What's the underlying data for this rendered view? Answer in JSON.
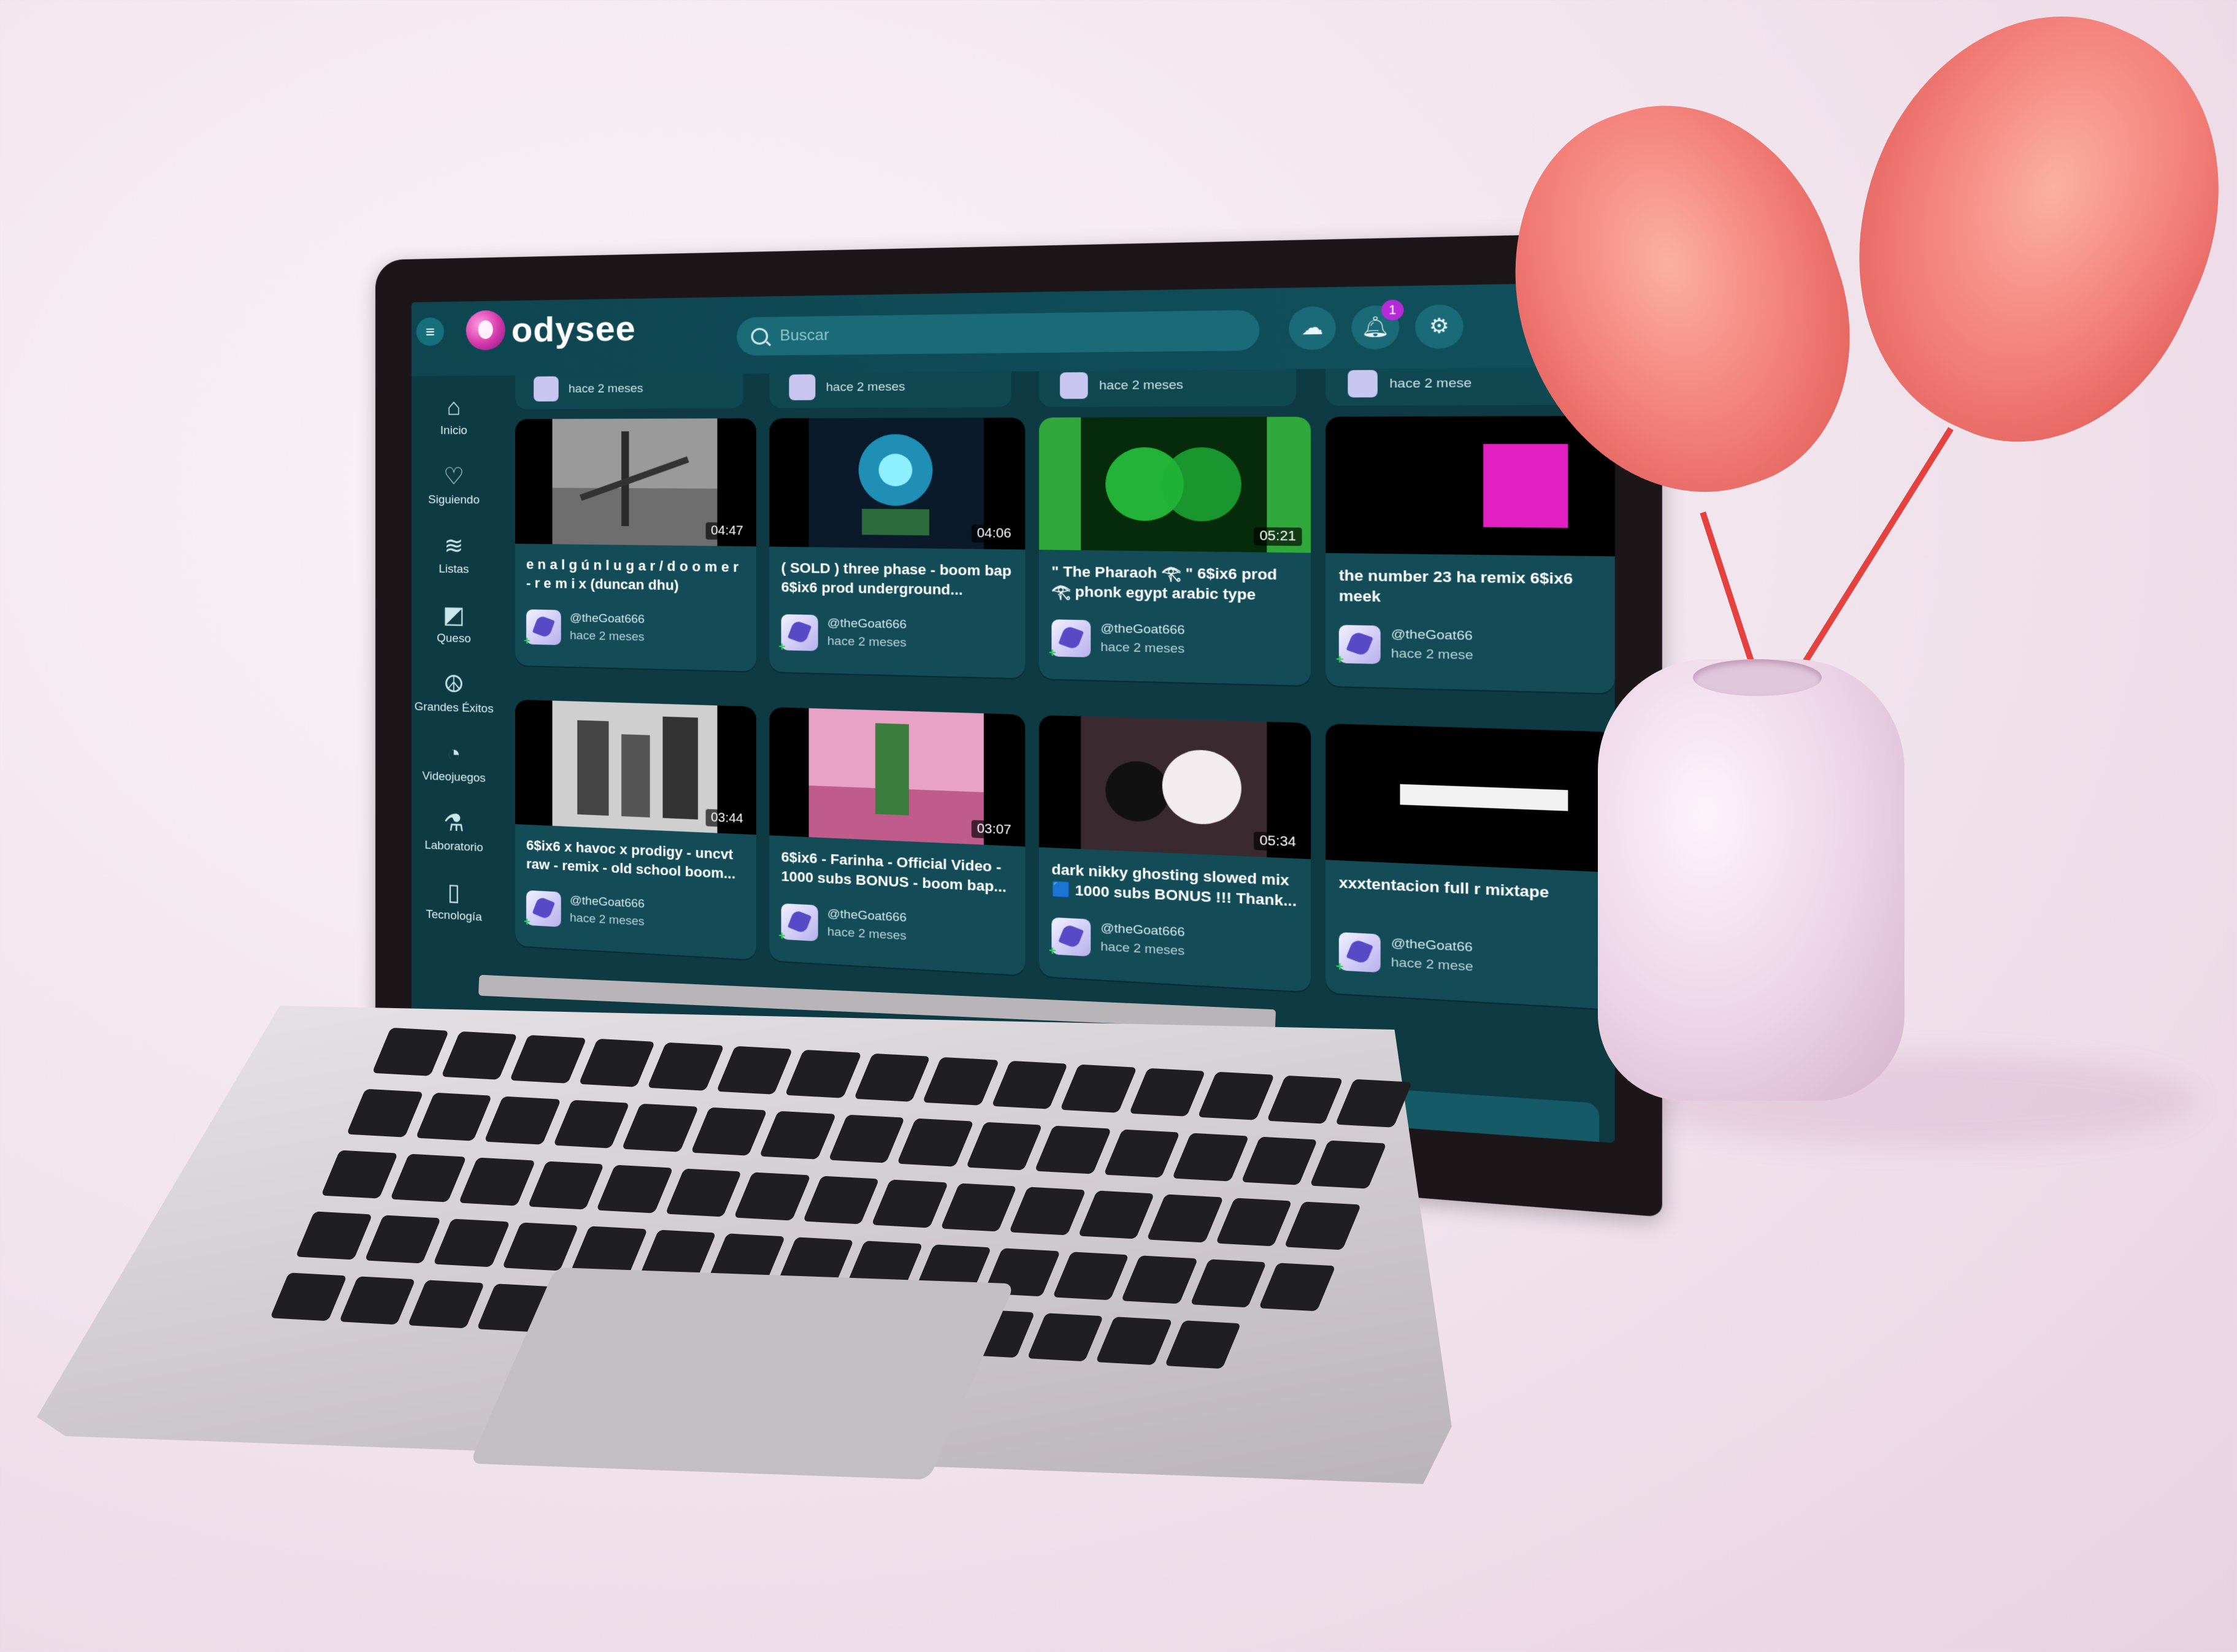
{
  "app": {
    "logo_text": "odysee"
  },
  "header": {
    "search_placeholder": "Buscar",
    "notification_count": "1",
    "icons": [
      "menu-icon",
      "upload-icon",
      "bell-icon",
      "gear-icon"
    ]
  },
  "sidebar": {
    "items": [
      {
        "label": "Inicio",
        "icon": "home-icon"
      },
      {
        "label": "Siguiendo",
        "icon": "heart-icon"
      },
      {
        "label": "Listas",
        "icon": "layers-icon"
      },
      {
        "label": "Queso",
        "icon": "cheese-icon"
      },
      {
        "label": "Grandes Éxitos",
        "icon": "peace-icon"
      },
      {
        "label": "Videojuegos",
        "icon": "ghost-icon"
      },
      {
        "label": "Laboratorio",
        "icon": "flask-icon"
      },
      {
        "label": "Tecnología",
        "icon": "phone-icon"
      }
    ]
  },
  "previous_row_times": [
    "hace 2 meses",
    "hace 2 meses",
    "hace 2 meses",
    "hace 2 mese"
  ],
  "videos": [
    {
      "title": "e n a l g ú n l u g a r / d o o m e r - r e m i x (duncan dhu)",
      "duration": "04:47",
      "channel": "@theGoat666",
      "time": "hace 2 meses"
    },
    {
      "title": "( SOLD ) three phase - boom bap 6$ix6 prod underground...",
      "duration": "04:06",
      "channel": "@theGoat666",
      "time": "hace 2 meses"
    },
    {
      "title": "\" The Pharaoh 𓂀 \" 6$ix6 prod 𓂀 phonk egypt arabic type beat...",
      "duration": "05:21",
      "channel": "@theGoat666",
      "time": "hace 2 meses"
    },
    {
      "title": "the number 23 ha remix 6$ix6 meek",
      "duration": "",
      "channel": "@theGoat66",
      "time": "hace 2 mese"
    },
    {
      "title": "6$ix6 x havoc x prodigy - uncvt raw - remix - old school boom...",
      "duration": "03:44",
      "channel": "@theGoat666",
      "time": "hace 2 meses"
    },
    {
      "title": "6$ix6 - Farinha - Official Video - 1000 subs BONUS - boom bap...",
      "duration": "03:07",
      "channel": "@theGoat666",
      "time": "hace 2 meses"
    },
    {
      "title": "dark nikky ghosting slowed mix 🟦 1000 subs BONUS !!! Thank...",
      "duration": "05:34",
      "channel": "@theGoat666",
      "time": "hace 2 meses"
    },
    {
      "title": "xxxtentacion full r mixtape",
      "duration": "",
      "channel": "@theGoat66",
      "time": "hace 2 mese"
    }
  ],
  "colors": {
    "screen_bg": "#0e3a44",
    "card_bg": "#134c57",
    "accent": "#b52bd8"
  }
}
